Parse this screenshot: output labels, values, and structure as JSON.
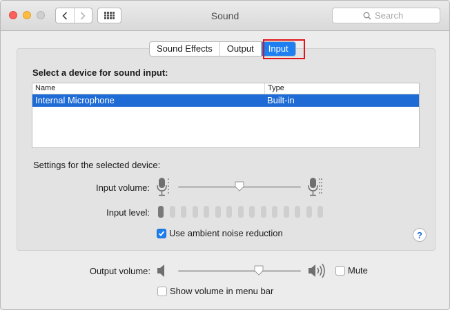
{
  "window": {
    "title": "Sound",
    "search": {
      "placeholder": "Search"
    }
  },
  "tabs": [
    {
      "label": "Sound Effects",
      "selected": false
    },
    {
      "label": "Output",
      "selected": false
    },
    {
      "label": "Input",
      "selected": true
    }
  ],
  "input": {
    "heading": "Select a device for sound input:",
    "columns": {
      "name": "Name",
      "type": "Type"
    },
    "devices": [
      {
        "name": "Internal Microphone",
        "type": "Built-in",
        "selected": true
      }
    ],
    "settings_label": "Settings for the selected device:",
    "input_volume_label": "Input volume:",
    "input_volume_fraction": 0.5,
    "input_level_label": "Input level:",
    "input_level_bars_total": 15,
    "input_level_bars_active": 1,
    "ambient_noise_label": "Use ambient noise reduction",
    "ambient_noise_checked": true,
    "help_label": "?"
  },
  "output": {
    "volume_label": "Output volume:",
    "volume_fraction": 0.67,
    "mute_label": "Mute",
    "mute_checked": false,
    "show_in_menu_bar_label": "Show volume in menu bar",
    "show_in_menu_bar_checked": false
  },
  "colors": {
    "accent": "#1e7ff0",
    "selection": "#1e6bd6",
    "highlight_annotation": "#e0121a"
  }
}
